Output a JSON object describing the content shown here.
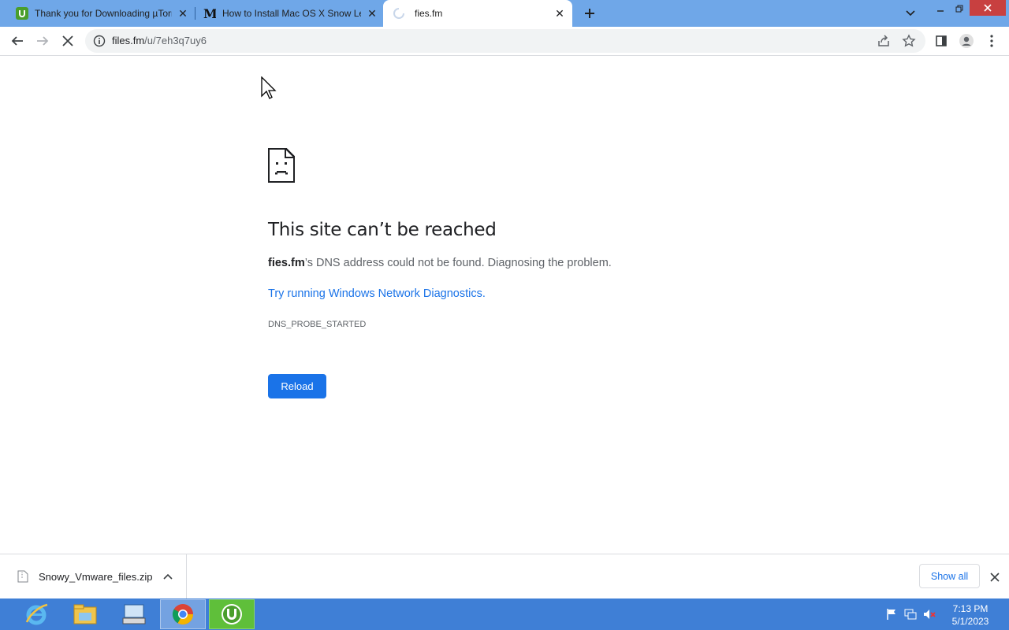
{
  "tabs": [
    {
      "title": "Thank you for Downloading µTorrent",
      "icon": "utorrent-favicon-icon"
    },
    {
      "title": "How to Install Mac OS X Snow Leopard",
      "icon": "medium-favicon-icon"
    },
    {
      "title": "fies.fm",
      "icon": "loading-spinner-icon",
      "active": true
    }
  ],
  "toolbar": {
    "url_host": "files.fm",
    "url_path": "/u/7eh3q7uy6"
  },
  "error_page": {
    "title": "This site can’t be reached",
    "host": "fies.fm",
    "description": "’s DNS address could not be found. Diagnosing the problem.",
    "link": "Try running Windows Network Diagnostics.",
    "code": "DNS_PROBE_STARTED",
    "reload_label": "Reload"
  },
  "download_shelf": {
    "file_name": "Snowy_Vmware_files.zip",
    "show_all_label": "Show all"
  },
  "taskbar": {
    "time": "7:13 PM",
    "date": "5/1/2023"
  },
  "colors": {
    "tabstrip": "#6fa7e8",
    "accent": "#1a73e8",
    "taskbar": "#3f7fd6"
  }
}
